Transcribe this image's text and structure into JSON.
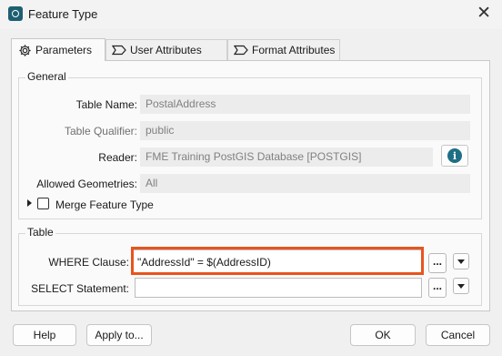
{
  "window": {
    "title": "Feature Type",
    "close_glyph": "✕"
  },
  "tabs": [
    {
      "label": "Parameters",
      "icon": "gear-icon",
      "active": true
    },
    {
      "label": "User Attributes",
      "icon": "tag-icon",
      "active": false
    },
    {
      "label": "Format Attributes",
      "icon": "tag-icon",
      "active": false
    }
  ],
  "general": {
    "title": "General",
    "table_name_label": "Table Name:",
    "table_name_value": "PostalAddress",
    "table_qualifier_label": "Table Qualifier:",
    "table_qualifier_value": "public",
    "reader_label": "Reader:",
    "reader_value": "FME Training PostGIS Database [POSTGIS]",
    "info_glyph": "i",
    "allowed_geometries_label": "Allowed Geometries:",
    "allowed_geometries_value": "All",
    "merge_label": "Merge Feature Type"
  },
  "table": {
    "title": "Table",
    "where_label": "WHERE Clause:",
    "where_value": "\"AddressId\" = $(AddressID)",
    "select_label": "SELECT Statement:",
    "select_value": "",
    "dots_label": "..."
  },
  "buttons": {
    "help": "Help",
    "apply": "Apply to...",
    "ok": "OK",
    "cancel": "Cancel"
  },
  "colors": {
    "highlight": "#e8541e",
    "info": "#1d6f85"
  }
}
